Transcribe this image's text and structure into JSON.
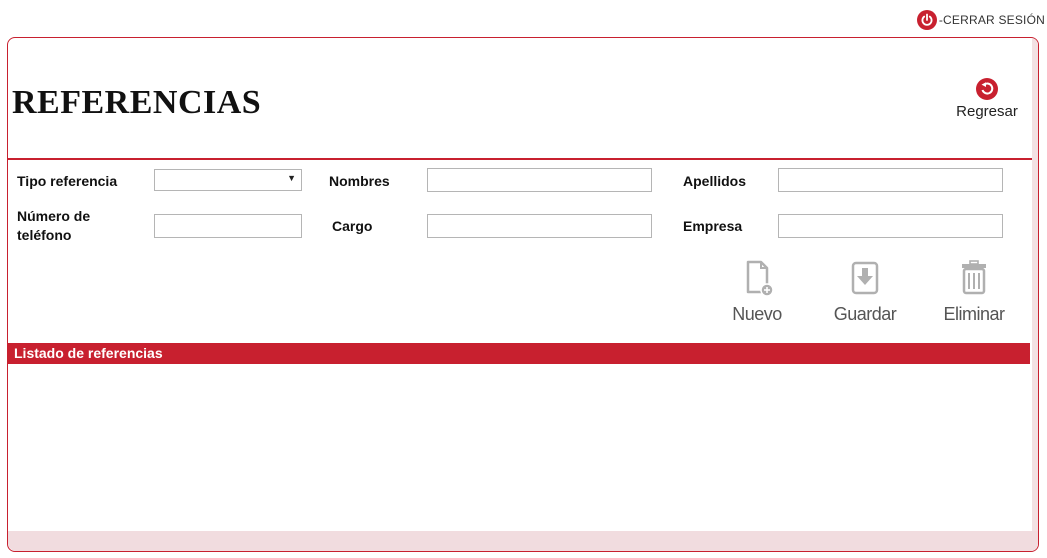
{
  "header": {
    "logout_label": "-CERRAR SESIÓN",
    "logout_icon": "power-icon"
  },
  "page": {
    "title": "REFERENCIAS",
    "back_label": "Regresar",
    "back_icon": "back-arrow-icon"
  },
  "form": {
    "tipo_referencia": {
      "label": "Tipo referencia",
      "value": ""
    },
    "nombres": {
      "label": "Nombres",
      "value": ""
    },
    "apellidos": {
      "label": "Apellidos",
      "value": ""
    },
    "numero_telefono": {
      "label": "Número de teléfono",
      "value": ""
    },
    "cargo": {
      "label": "Cargo",
      "value": ""
    },
    "empresa": {
      "label": "Empresa",
      "value": ""
    }
  },
  "actions": {
    "nuevo": {
      "label": "Nuevo",
      "icon": "new-document-icon"
    },
    "guardar": {
      "label": "Guardar",
      "icon": "save-download-icon"
    },
    "eliminar": {
      "label": "Eliminar",
      "icon": "trash-icon"
    }
  },
  "list": {
    "header": "Listado de referencias",
    "rows": []
  },
  "colors": {
    "accent": "#c8202f",
    "panel_footer": "#f1dcdf"
  }
}
